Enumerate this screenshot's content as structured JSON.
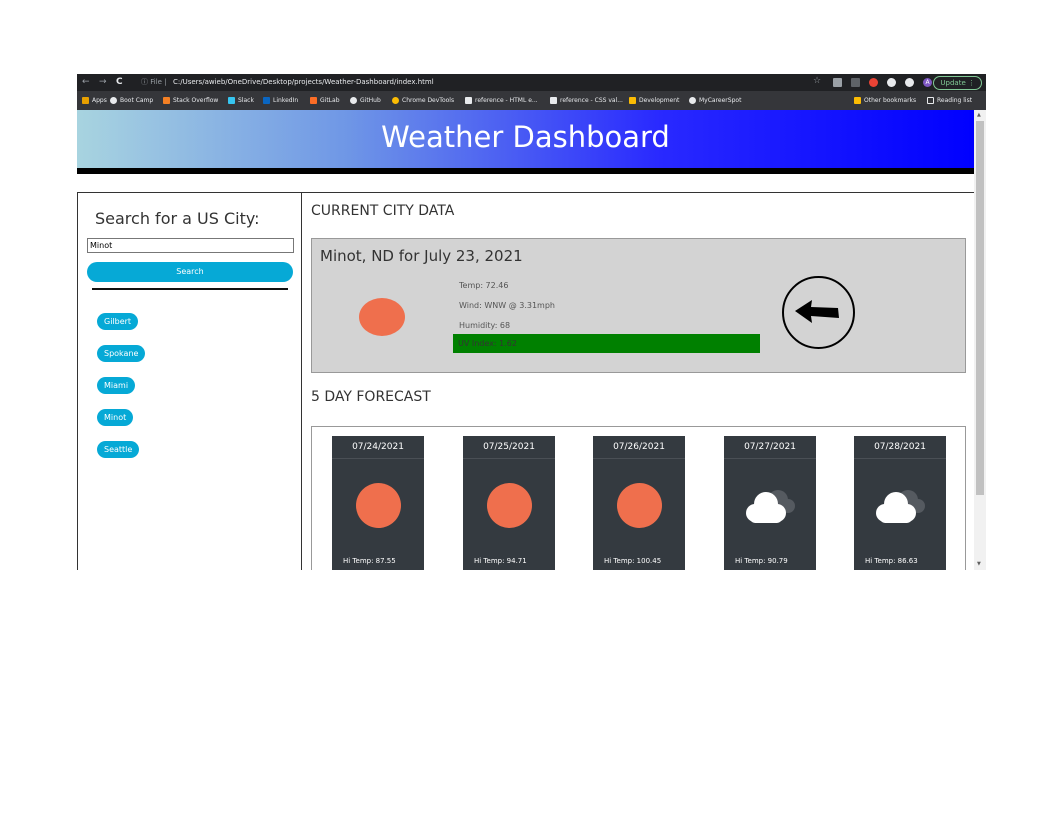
{
  "browser": {
    "url": "C:/Users/awieb/OneDrive/Desktop/projects/Weather-Dashboard/index.html",
    "file_label": "File",
    "update_label": "Update",
    "profile_initial": "A"
  },
  "bookmarks": {
    "left": [
      "Apps",
      "Boot Camp",
      "Stack Overflow",
      "Slack",
      "LinkedIn",
      "GitLab",
      "GitHub",
      "Chrome DevTools",
      "reference - HTML e...",
      "reference - CSS val...",
      "Development",
      "MyCareerSpot"
    ],
    "other": "Other bookmarks",
    "reading": "Reading list"
  },
  "header": {
    "title": "Weather Dashboard"
  },
  "sidebar": {
    "heading": "Search for a US City:",
    "input_value": "Minot",
    "search_label": "Search",
    "history": [
      "Gilbert",
      "Spokane",
      "Miami",
      "Minot",
      "Seattle"
    ]
  },
  "current": {
    "section_title": "CURRENT CITY DATA",
    "city_line": "Minot, ND for July 23, 2021",
    "temp": "Temp: 72.46",
    "wind": "Wind: WNW @ 3.31mph",
    "humidity": "Humidity: 68",
    "uv": "UV Index: 1.62",
    "uv_color": "#008000",
    "weather_icon": "sun-icon",
    "wind_icon": "wind-direction-arrow-icon"
  },
  "forecast": {
    "section_title": "5 DAY FORECAST",
    "days": [
      {
        "date": "07/24/2021",
        "icon": "sun",
        "hi": "Hi Temp: 87.55"
      },
      {
        "date": "07/25/2021",
        "icon": "sun",
        "hi": "Hi Temp: 94.71"
      },
      {
        "date": "07/26/2021",
        "icon": "sun",
        "hi": "Hi Temp: 100.45"
      },
      {
        "date": "07/27/2021",
        "icon": "cloud",
        "hi": "Hi Temp: 90.79"
      },
      {
        "date": "07/28/2021",
        "icon": "cloud",
        "hi": "Hi Temp: 86.63"
      }
    ]
  },
  "colors": {
    "accent": "#06a9d6",
    "sun": "#ef6f4d",
    "card_bg": "#343a40"
  }
}
